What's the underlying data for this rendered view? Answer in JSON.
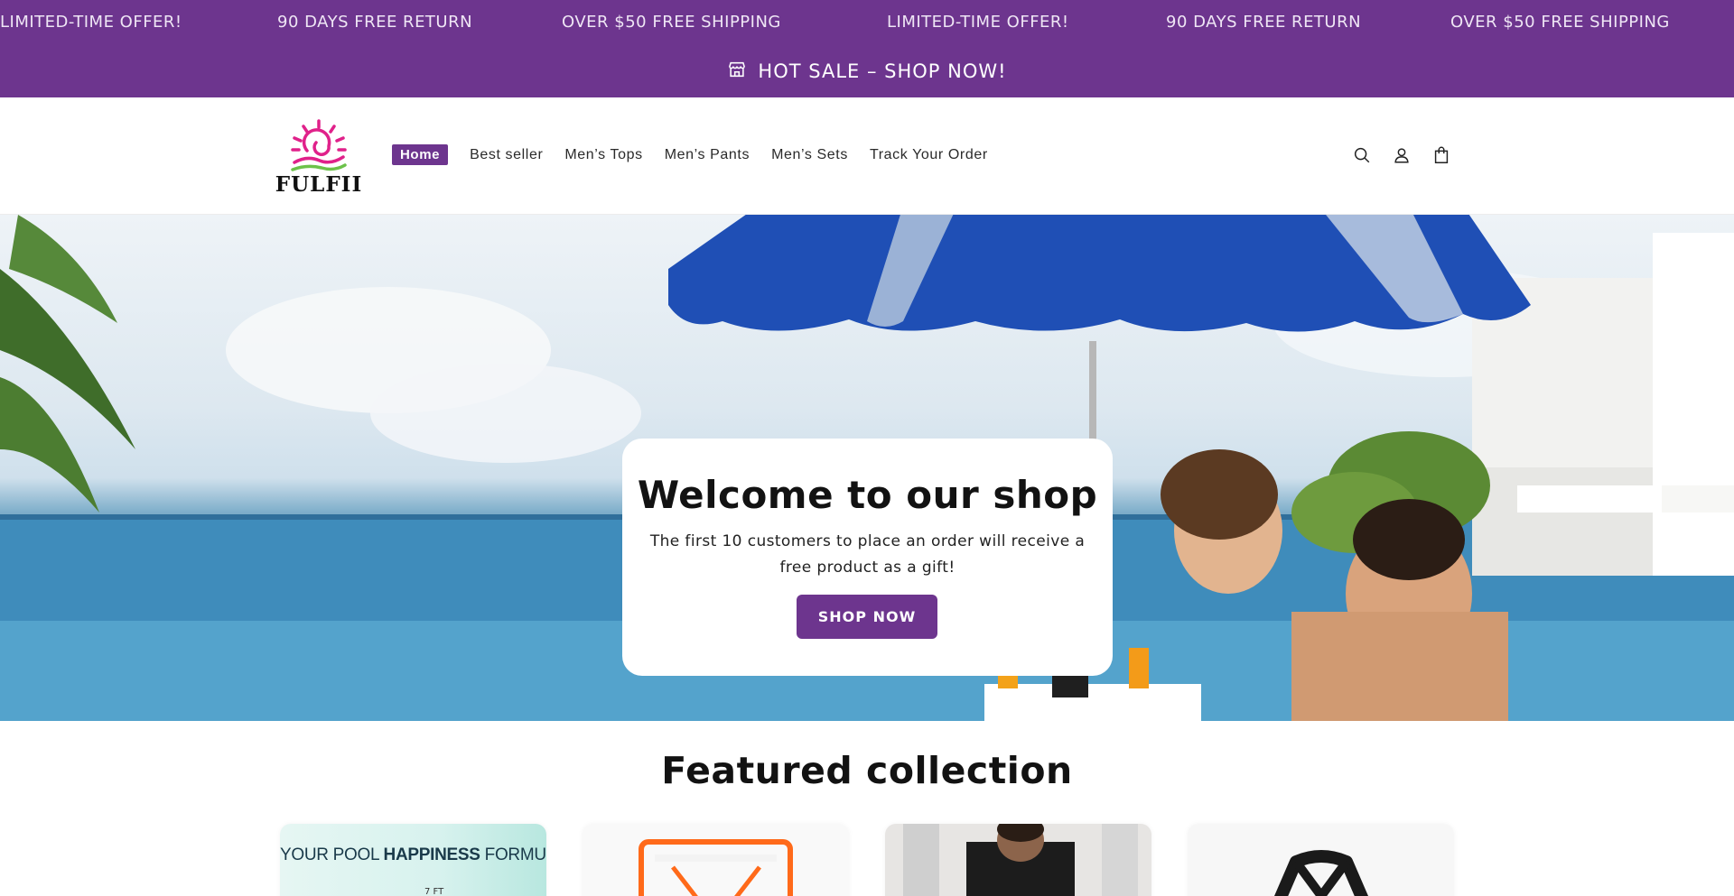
{
  "announcement": {
    "ticker": [
      "LIMITED-TIME OFFER!",
      "90 DAYS FREE RETURN",
      "OVER $50 FREE SHIPPING",
      "LIMITED-TIME OFFER!",
      "90 DAYS FREE RETURN",
      "OVER $50 FREE SHIPPING"
    ],
    "hot_sale": "HOT SALE – SHOP NOW!",
    "hot_sale_icon": "store-icon",
    "background_color": "#6d358e"
  },
  "header": {
    "logo_text": "FULFII",
    "logo_icon": "sun-logo-icon",
    "nav": [
      {
        "label": "Home",
        "active": true
      },
      {
        "label": "Best seller",
        "active": false
      },
      {
        "label": "Men’s Tops",
        "active": false
      },
      {
        "label": "Men’s Pants",
        "active": false
      },
      {
        "label": "Men’s Sets",
        "active": false
      },
      {
        "label": "Track Your Order",
        "active": false
      }
    ],
    "icons": [
      "search-icon",
      "account-icon",
      "cart-icon"
    ]
  },
  "hero": {
    "title": "Welcome to our shop",
    "subtitle": "The first 10 customers to place an order will receive a free product as a gift!",
    "button": "SHOP NOW",
    "accent_color": "#6d358e"
  },
  "featured": {
    "title": "Featured collection",
    "cards": [
      {
        "text_normal_1": "YOUR POOL ",
        "text_bold": "HAPPINESS",
        "text_normal_2": " FORMUL",
        "sub": "7 FT"
      },
      {},
      {},
      {}
    ]
  }
}
